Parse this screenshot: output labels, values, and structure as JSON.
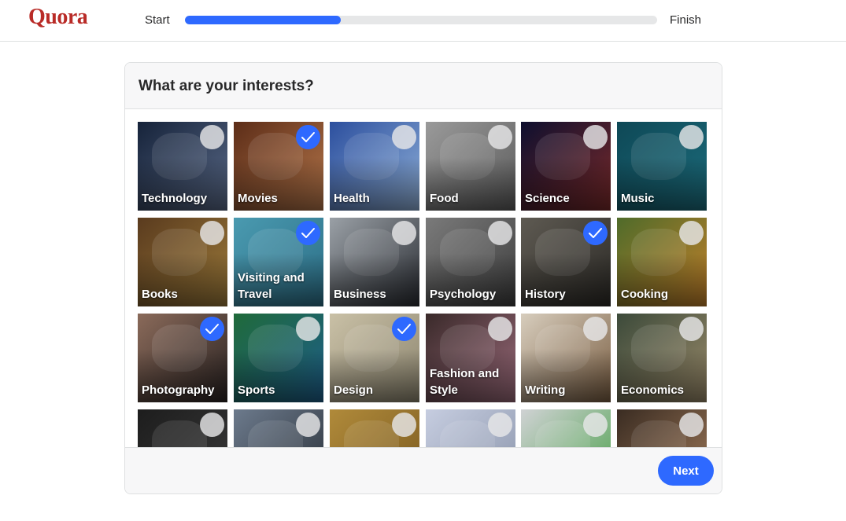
{
  "app": {
    "logo_text": "Quora",
    "brand_color": "#b92b27",
    "accent_color": "#2e69ff"
  },
  "progress": {
    "start_label": "Start",
    "finish_label": "Finish",
    "value": 0.33
  },
  "dialog": {
    "title": "What are your interests?",
    "next_label": "Next",
    "topics": [
      {
        "label": "Technology",
        "selected": false,
        "bg": "#16233a",
        "bg2": "#5a6a88",
        "icon": "astronaut-photo"
      },
      {
        "label": "Movies",
        "selected": true,
        "bg": "#5c2d18",
        "bg2": "#b5764a",
        "icon": "film-reel-photo"
      },
      {
        "label": "Health",
        "selected": false,
        "bg": "#2c4f9e",
        "bg2": "#8fb0d8",
        "icon": "yoga-photo"
      },
      {
        "label": "Food",
        "selected": false,
        "bg": "#9a9a9a",
        "bg2": "#5b5b5b",
        "icon": "fast-food-photo"
      },
      {
        "label": "Science",
        "selected": false,
        "bg": "#0e0f2e",
        "bg2": "#7a2a2a",
        "icon": "dna-photo"
      },
      {
        "label": "Music",
        "selected": false,
        "bg": "#0e4856",
        "bg2": "#1c6c7c",
        "icon": "microphone-photo"
      },
      {
        "label": "Books",
        "selected": false,
        "bg": "#5a3b1e",
        "bg2": "#9c7a3a",
        "icon": "books-photo"
      },
      {
        "label": "Visiting and Travel",
        "selected": true,
        "bg": "#4a9ab0",
        "bg2": "#2c6e86",
        "icon": "resort-photo"
      },
      {
        "label": "Business",
        "selected": false,
        "bg": "#9aa0a6",
        "bg2": "#2a2d33",
        "icon": "business-people-photo"
      },
      {
        "label": "Psychology",
        "selected": false,
        "bg": "#7a7a7a",
        "bg2": "#3e3e3e",
        "icon": "head-maze-photo"
      },
      {
        "label": "History",
        "selected": true,
        "bg": "#5e5a52",
        "bg2": "#2c2a26",
        "icon": "old-city-photo"
      },
      {
        "label": "Cooking",
        "selected": false,
        "bg": "#4f6b2a",
        "bg2": "#c2802a",
        "icon": "salad-photo"
      },
      {
        "label": "Photography",
        "selected": true,
        "bg": "#8a6a5a",
        "bg2": "#2a2322",
        "icon": "camera-photo"
      },
      {
        "label": "Sports",
        "selected": false,
        "bg": "#1f6a3a",
        "bg2": "#1e5e8a",
        "icon": "sports-pictograms-photo"
      },
      {
        "label": "Design",
        "selected": true,
        "bg": "#c9c0a6",
        "bg2": "#8d8670",
        "icon": "blueprint-photo"
      },
      {
        "label": "Fashion and Style",
        "selected": false,
        "bg": "#3a2a2a",
        "bg2": "#9a6a7a",
        "icon": "fashion-photo"
      },
      {
        "label": "Writing",
        "selected": false,
        "bg": "#d7cdbd",
        "bg2": "#7a5e42",
        "icon": "pen-writing-photo"
      },
      {
        "label": "Economics",
        "selected": false,
        "bg": "#3c4a3a",
        "bg2": "#9a8a6a",
        "icon": "coins-chart-photo"
      },
      {
        "label": "",
        "selected": false,
        "bg": "#1d1d1d",
        "bg2": "#3a3a3a",
        "icon": "chalkboard-photo"
      },
      {
        "label": "",
        "selected": false,
        "bg": "#6c7a8c",
        "bg2": "#2a3038",
        "icon": "thinker-statue-photo"
      },
      {
        "label": "",
        "selected": false,
        "bg": "#b08a3a",
        "bg2": "#7a5a20",
        "icon": "parchment-photo"
      },
      {
        "label": "",
        "selected": false,
        "bg": "#c6cde0",
        "bg2": "#8a94aa",
        "icon": "tax-form-photo"
      },
      {
        "label": "",
        "selected": false,
        "bg": "#d0d2d4",
        "bg2": "#4aa04a",
        "icon": "keyboard-photo"
      },
      {
        "label": "",
        "selected": false,
        "bg": "#3a2c22",
        "bg2": "#a07a5a",
        "icon": "family-photo"
      }
    ]
  }
}
